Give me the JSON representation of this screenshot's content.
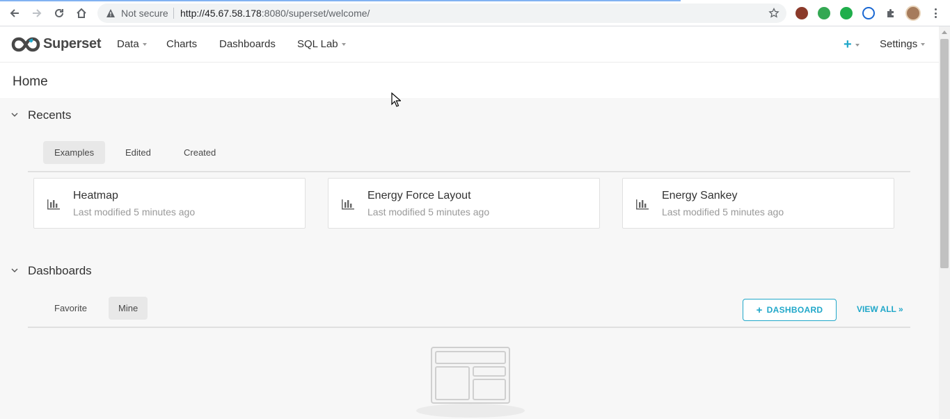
{
  "browser": {
    "security_label": "Not secure",
    "url_host": "http://45.67.58.178",
    "url_rest": ":8080/superset/welcome/",
    "icons": [
      "back-icon",
      "forward-icon",
      "reload-icon",
      "home-icon",
      "warning-icon",
      "star-icon",
      "extension-icon",
      "puzzle-icon",
      "avatar",
      "menu-icon"
    ]
  },
  "nav": {
    "brand": "Superset",
    "items": [
      {
        "label": "Data",
        "dropdown": true
      },
      {
        "label": "Charts",
        "dropdown": false
      },
      {
        "label": "Dashboards",
        "dropdown": false
      },
      {
        "label": "SQL Lab",
        "dropdown": true
      }
    ],
    "add_label": "+",
    "settings_label": "Settings"
  },
  "page": {
    "title": "Home"
  },
  "recents": {
    "title": "Recents",
    "tabs": [
      {
        "label": "Examples",
        "active": true
      },
      {
        "label": "Edited",
        "active": false
      },
      {
        "label": "Created",
        "active": false
      }
    ],
    "cards": [
      {
        "title": "Heatmap",
        "subtitle": "Last modified 5 minutes ago",
        "icon": "bar-chart-icon"
      },
      {
        "title": "Energy Force Layout",
        "subtitle": "Last modified 5 minutes ago",
        "icon": "bar-chart-icon"
      },
      {
        "title": "Energy Sankey",
        "subtitle": "Last modified 5 minutes ago",
        "icon": "bar-chart-icon"
      }
    ]
  },
  "dashboards": {
    "title": "Dashboards",
    "tabs": [
      {
        "label": "Favorite",
        "active": false
      },
      {
        "label": "Mine",
        "active": true
      }
    ],
    "add_button_label": "DASHBOARD",
    "add_button_plus": "+",
    "view_all_label": "VIEW ALL »"
  },
  "colors": {
    "accent": "#20a7c9",
    "text": "#323232",
    "muted": "#999999",
    "background": "#f7f7f7"
  }
}
